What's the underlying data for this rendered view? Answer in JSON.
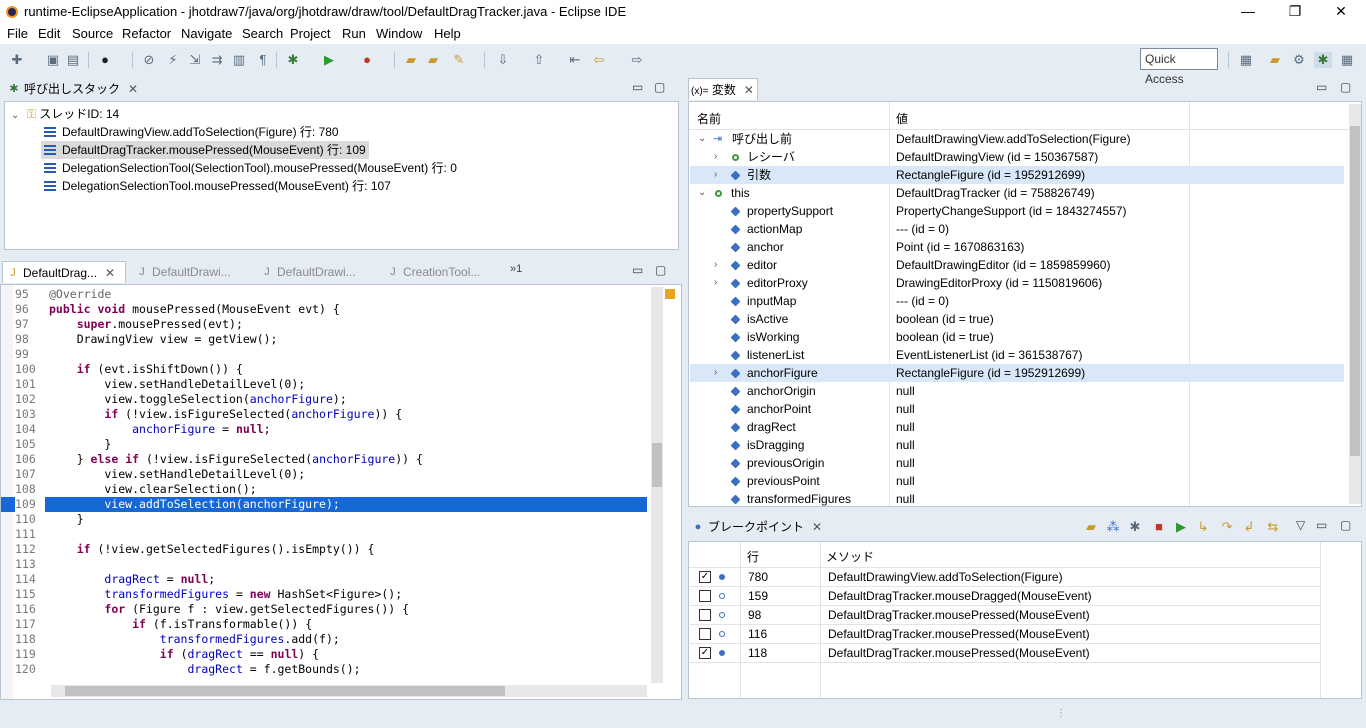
{
  "window": {
    "title": "runtime-EclipseApplication - jhotdraw7/java/org/jhotdraw/draw/tool/DefaultDragTracker.java - Eclipse IDE",
    "minimize": "—",
    "restore": "❐",
    "close": "✕"
  },
  "menu": [
    "File",
    "Edit",
    "Source",
    "Refactor",
    "Navigate",
    "Search",
    "Project",
    "Run",
    "Window",
    "Help"
  ],
  "toolbar": {
    "quick_access": "Quick Access"
  },
  "callstack": {
    "tab": "呼び出しスタック",
    "thread": "スレッドID: 14",
    "frames": [
      "DefaultDrawingView.addToSelection(Figure) 行: 780",
      "DefaultDragTracker.mousePressed(MouseEvent) 行: 109",
      "DelegationSelectionTool(SelectionTool).mousePressed(MouseEvent) 行: 0",
      "DelegationSelectionTool.mousePressed(MouseEvent) 行: 107"
    ]
  },
  "editor": {
    "tabs": [
      "DefaultDrag...",
      "DefaultDrawi...",
      "DefaultDrawi...",
      "CreationTool..."
    ],
    "overflow": "»1",
    "lines": [
      {
        "n": "95",
        "t": "@Override"
      },
      {
        "n": "96",
        "t": "public void mousePressed(MouseEvent evt) {"
      },
      {
        "n": "97",
        "t": "    super.mousePressed(evt);"
      },
      {
        "n": "98",
        "t": "    DrawingView view = getView();"
      },
      {
        "n": "99",
        "t": ""
      },
      {
        "n": "100",
        "t": "    if (evt.isShiftDown()) {"
      },
      {
        "n": "101",
        "t": "        view.setHandleDetailLevel(0);"
      },
      {
        "n": "102",
        "t": "        view.toggleSelection(anchorFigure);"
      },
      {
        "n": "103",
        "t": "        if (!view.isFigureSelected(anchorFigure)) {"
      },
      {
        "n": "104",
        "t": "            anchorFigure = null;"
      },
      {
        "n": "105",
        "t": "        }"
      },
      {
        "n": "106",
        "t": "    } else if (!view.isFigureSelected(anchorFigure)) {"
      },
      {
        "n": "107",
        "t": "        view.setHandleDetailLevel(0);"
      },
      {
        "n": "108",
        "t": "        view.clearSelection();"
      },
      {
        "n": "109",
        "t": "        view.addToSelection(anchorFigure);"
      },
      {
        "n": "110",
        "t": "    }"
      },
      {
        "n": "111",
        "t": ""
      },
      {
        "n": "112",
        "t": "    if (!view.getSelectedFigures().isEmpty()) {"
      },
      {
        "n": "113",
        "t": ""
      },
      {
        "n": "114",
        "t": "        dragRect = null;"
      },
      {
        "n": "115",
        "t": "        transformedFigures = new HashSet<Figure>();"
      },
      {
        "n": "116",
        "t": "        for (Figure f : view.getSelectedFigures()) {"
      },
      {
        "n": "117",
        "t": "            if (f.isTransformable()) {"
      },
      {
        "n": "118",
        "t": "                transformedFigures.add(f);"
      },
      {
        "n": "119",
        "t": "                if (dragRect == null) {"
      },
      {
        "n": "120",
        "t": "                    dragRect = f.getBounds();"
      }
    ]
  },
  "variables": {
    "tab": "変数",
    "tab_prefix": "(x)=",
    "col_name": "名前",
    "col_value": "値",
    "rows": [
      {
        "name": "呼び出し前",
        "value": "DefaultDrawingView.addToSelection(Figure)"
      },
      {
        "name": "レシーバ",
        "value": "DefaultDrawingView (id = 150367587)"
      },
      {
        "name": "引数",
        "value": "RectangleFigure (id = 1952912699)"
      },
      {
        "name": "this",
        "value": "DefaultDragTracker (id = 758826749)"
      },
      {
        "name": "propertySupport",
        "value": "PropertyChangeSupport (id = 1843274557)"
      },
      {
        "name": "actionMap",
        "value": "--- (id = 0)"
      },
      {
        "name": "anchor",
        "value": "Point (id = 1670863163)"
      },
      {
        "name": "editor",
        "value": "DefaultDrawingEditor (id = 1859859960)"
      },
      {
        "name": "editorProxy",
        "value": "DrawingEditorProxy (id = 1150819606)"
      },
      {
        "name": "inputMap",
        "value": "--- (id = 0)"
      },
      {
        "name": "isActive",
        "value": "boolean (id = true)"
      },
      {
        "name": "isWorking",
        "value": "boolean (id = true)"
      },
      {
        "name": "listenerList",
        "value": "EventListenerList (id = 361538767)"
      },
      {
        "name": "anchorFigure",
        "value": "RectangleFigure (id = 1952912699)"
      },
      {
        "name": "anchorOrigin",
        "value": "null"
      },
      {
        "name": "anchorPoint",
        "value": "null"
      },
      {
        "name": "dragRect",
        "value": "null"
      },
      {
        "name": "isDragging",
        "value": "null"
      },
      {
        "name": "previousOrigin",
        "value": "null"
      },
      {
        "name": "previousPoint",
        "value": "null"
      },
      {
        "name": "transformedFigures",
        "value": "null"
      }
    ]
  },
  "breakpoints": {
    "tab": "ブレークポイント",
    "col_line": "行",
    "col_method": "メソッド",
    "rows": [
      {
        "line": "780",
        "method": "DefaultDrawingView.addToSelection(Figure)",
        "checked": true
      },
      {
        "line": "159",
        "method": "DefaultDragTracker.mouseDragged(MouseEvent)",
        "checked": false
      },
      {
        "line": "98",
        "method": "DefaultDragTracker.mousePressed(MouseEvent)",
        "checked": false
      },
      {
        "line": "116",
        "method": "DefaultDragTracker.mousePressed(MouseEvent)",
        "checked": false
      },
      {
        "line": "118",
        "method": "DefaultDragTracker.mousePressed(MouseEvent)",
        "checked": true
      }
    ]
  },
  "colors": {
    "accent": "#1668d6",
    "keyword": "#7f0055",
    "field": "#0000c0",
    "selection_light": "#d9e8f9"
  }
}
